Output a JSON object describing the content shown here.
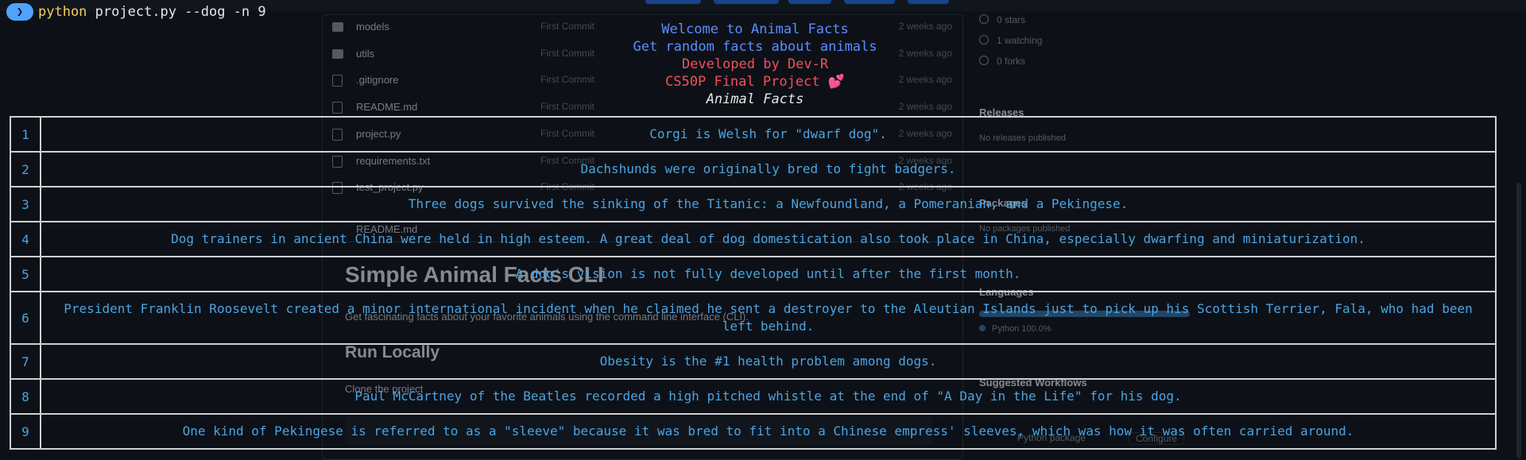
{
  "terminal": {
    "prompt_symbol": "❯",
    "command_program": "python",
    "command_args": "project.py --dog -n 9",
    "banner": [
      "Welcome to Animal Facts",
      "Get random facts about animals",
      "Developed by Dev-R",
      "CS50P Final Project",
      "Animal Facts"
    ],
    "heart_glyph": "💕",
    "facts": [
      {
        "n": "1",
        "text": "Corgi is Welsh for \"dwarf dog\"."
      },
      {
        "n": "2",
        "text": "Dachshunds were originally bred to fight badgers."
      },
      {
        "n": "3",
        "text": "Three dogs survived the sinking of the Titanic: a Newfoundland, a Pomeranian, and a Pekingese."
      },
      {
        "n": "4",
        "text": "Dog trainers in ancient China were held in high esteem. A great deal of dog domestication also took place in China, especially dwarfing and miniaturization."
      },
      {
        "n": "5",
        "text": "A dog's vision is not fully developed until after the first month."
      },
      {
        "n": "6",
        "text": "President Franklin Roosevelt created a minor international incident when he claimed he sent a destroyer to the Aleutian Islands just to pick up his Scottish Terrier, Fala, who had been left behind."
      },
      {
        "n": "7",
        "text": "Obesity is the #1 health problem among dogs."
      },
      {
        "n": "8",
        "text": "Paul McCartney of the Beatles recorded a high pitched whistle at the end of \"A Day in the Life\" for his dog."
      },
      {
        "n": "9",
        "text": "One kind of Pekingese is referred to as a \"sleeve\" because it was bred to fit into a Chinese empress' sleeves, which was how it was often carried around."
      }
    ]
  },
  "background": {
    "files": [
      {
        "name": "models",
        "msg": "First Commit",
        "date": "2 weeks ago",
        "type": "dir"
      },
      {
        "name": "utils",
        "msg": "First Commit",
        "date": "2 weeks ago",
        "type": "dir"
      },
      {
        "name": ".gitignore",
        "msg": "First Commit",
        "date": "2 weeks ago",
        "type": "file"
      },
      {
        "name": "README.md",
        "msg": "First Commit",
        "date": "2 weeks ago",
        "type": "file"
      },
      {
        "name": "project.py",
        "msg": "First Commit",
        "date": "2 weeks ago",
        "type": "file"
      },
      {
        "name": "requirements.txt",
        "msg": "First Commit",
        "date": "2 weeks ago",
        "type": "file"
      },
      {
        "name": "test_project.py",
        "msg": "First Commit",
        "date": "2 weeks ago",
        "type": "file"
      }
    ],
    "readme_label": "README.md",
    "readme_title": "Simple Animal Facts CLI",
    "readme_desc": "Get fascinating facts about your favorite animals using the command line interface (CLI).",
    "run_locally": "Run Locally",
    "clone_text": "Clone the project",
    "sidebar": {
      "stars": "0 stars",
      "watching": "1 watching",
      "forks": "0 forks",
      "releases_title": "Releases",
      "releases_none": "No releases published",
      "packages_title": "Packages",
      "packages_none": "No packages published",
      "languages_title": "Languages",
      "language": "Python 100.0%",
      "workflows_title": "Suggested Workflows",
      "workflow_name": "Python package",
      "configure": "Configure"
    }
  }
}
